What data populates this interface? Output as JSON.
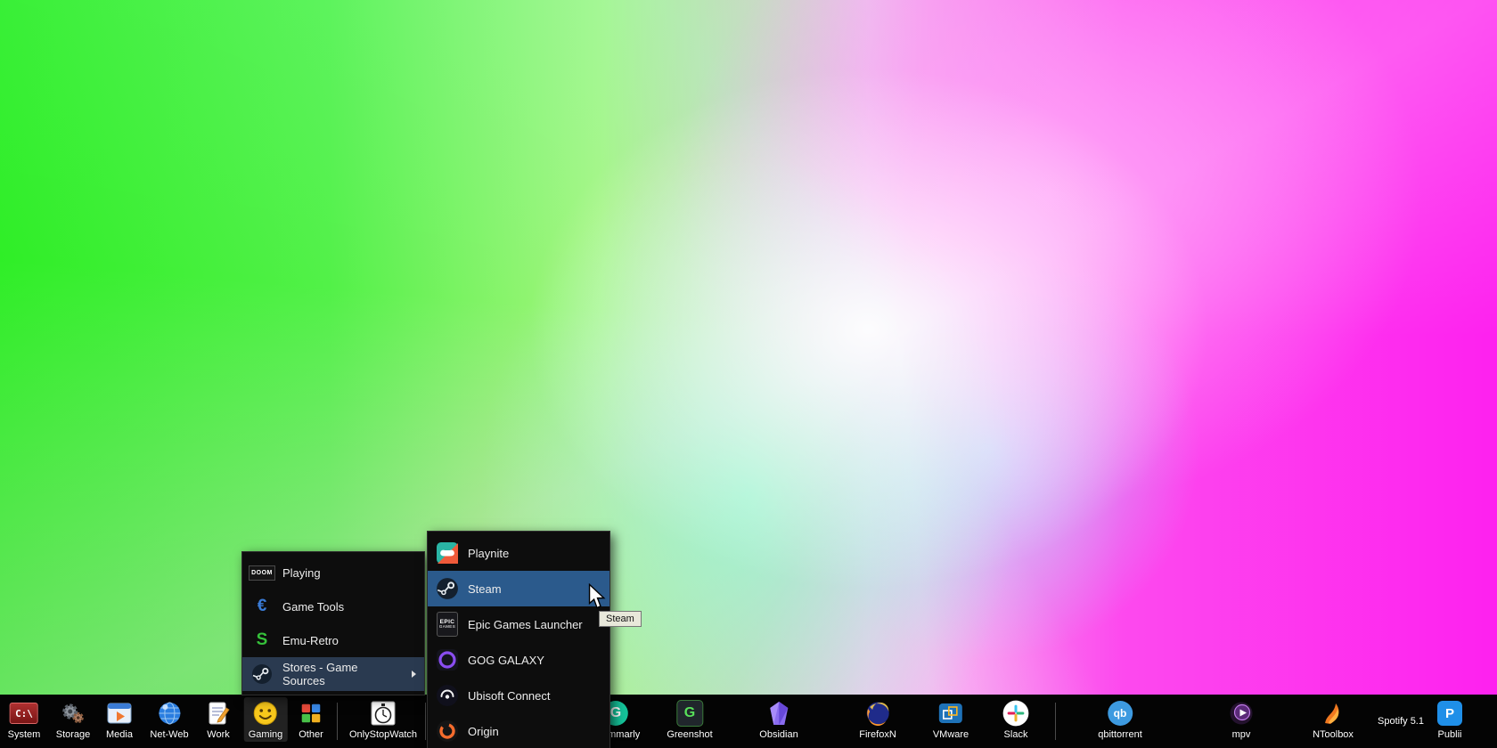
{
  "colors": {
    "taskbar_bg": "#040404",
    "menu_bg": "#0d0d0d",
    "menu_highlight_blue": "#2b5a8c",
    "menu_highlight_muted": "#2a3a50",
    "wallpaper_green": "#2fee27",
    "wallpaper_magenta": "#fe21ef"
  },
  "menus": {
    "gaming_menu": {
      "items": [
        {
          "label": "Playing",
          "icon": "doom-icon",
          "icon_text": "DOOM"
        },
        {
          "label": "Game Tools",
          "icon": "cheat-engine-icon",
          "icon_text": "€"
        },
        {
          "label": "Emu-Retro",
          "icon": "emulator-icon",
          "icon_text": "S"
        },
        {
          "label": "Stores - Game Sources",
          "icon": "steam-icon",
          "highlighted": true,
          "has_submenu": true
        }
      ]
    },
    "stores_submenu": {
      "items": [
        {
          "label": "Playnite",
          "icon": "playnite-icon"
        },
        {
          "label": "Steam",
          "icon": "steam-icon",
          "highlighted": true
        },
        {
          "label": "Epic Games Launcher",
          "icon": "epic-games-icon",
          "icon_text": "EPIC",
          "icon_text2": "GAMES"
        },
        {
          "label": "GOG GALAXY",
          "icon": "gog-galaxy-icon"
        },
        {
          "label": "Ubisoft Connect",
          "icon": "ubisoft-icon"
        },
        {
          "label": "Origin",
          "icon": "origin-icon"
        }
      ]
    },
    "tooltip_text": "Steam"
  },
  "taskbar": {
    "items": [
      {
        "label": "System",
        "icon": "system-drive-icon",
        "icon_text": "C:\\"
      },
      {
        "label": "Storage",
        "icon": "storage-gears-icon"
      },
      {
        "label": "Media",
        "icon": "media-player-icon"
      },
      {
        "label": "Net-Web",
        "icon": "network-globe-icon"
      },
      {
        "label": "Work",
        "icon": "work-notes-icon"
      },
      {
        "label": "Gaming",
        "icon": "gaming-smiley-icon",
        "active": true
      },
      {
        "label": "Other",
        "icon": "other-blocks-icon"
      },
      {
        "label": "OnlyStopWatch",
        "icon": "stopwatch-icon"
      },
      {
        "label": "Grammarly",
        "icon": "grammarly-icon",
        "icon_text": "G"
      },
      {
        "label": "Greenshot",
        "icon": "greenshot-icon",
        "icon_text": "G"
      },
      {
        "label": "Obsidian",
        "icon": "obsidian-icon"
      },
      {
        "label": "FirefoxN",
        "icon": "firefox-icon"
      },
      {
        "label": "VMware",
        "icon": "vmware-icon"
      },
      {
        "label": "Slack",
        "icon": "slack-icon"
      },
      {
        "label": "qbittorrent",
        "icon": "qbittorrent-icon",
        "icon_text": "qb"
      },
      {
        "label": "mpv",
        "icon": "mpv-icon"
      },
      {
        "label": "NToolbox",
        "icon": "ntoolbox-icon"
      },
      {
        "label": "Spotify 5.1",
        "icon": "none"
      },
      {
        "label": "Publii",
        "icon": "publii-icon",
        "icon_text": "P"
      }
    ]
  }
}
